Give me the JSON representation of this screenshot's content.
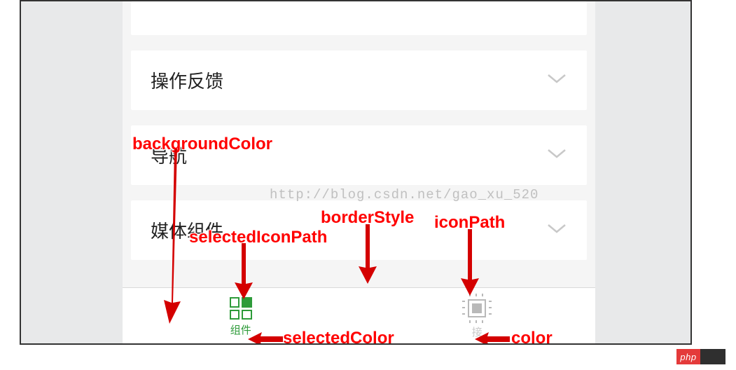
{
  "colors": {
    "annotation": "#ff0000",
    "selected": "#2e9b3a",
    "unselected": "#c8c8c8",
    "border": "#d9d9d9"
  },
  "list": {
    "items": [
      {
        "label": "操作反馈"
      },
      {
        "label": "导航"
      },
      {
        "label": "媒体组件"
      }
    ]
  },
  "watermark": "http://blog.csdn.net/gao_xu_520",
  "tabbar": {
    "items": [
      {
        "label": "组件",
        "selected": true
      },
      {
        "label": "接",
        "selected": false
      }
    ]
  },
  "annotations": {
    "backgroundColor": "backgroundColor",
    "selectedIconPath": "selectedIconPath",
    "borderStyle": "borderStyle",
    "iconPath": "iconPath",
    "selectedColor": "selectedColor",
    "color": "color"
  },
  "badge": "php"
}
